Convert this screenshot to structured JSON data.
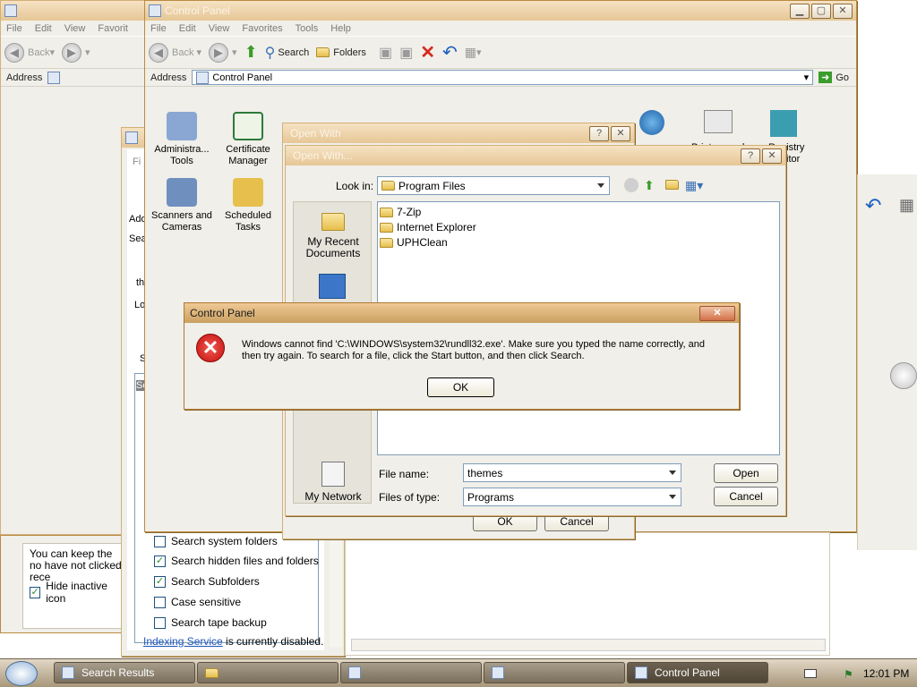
{
  "explorer_left": {
    "menu": [
      "File",
      "Edit",
      "View",
      "Favorit"
    ],
    "back_label": "Back",
    "address_label": "Address"
  },
  "control_panel": {
    "title": "Control Panel",
    "menu": [
      "File",
      "Edit",
      "View",
      "Favorites",
      "Tools",
      "Help"
    ],
    "toolbar": {
      "back": "Back",
      "search": "Search",
      "folders": "Folders"
    },
    "address_label": "Address",
    "address_value": "Control Panel",
    "go_label": "Go",
    "items": [
      {
        "label": "Administra... Tools",
        "icon": "admin-tools-icon",
        "color": "#8aa6d2"
      },
      {
        "label": "Certificate Manager",
        "icon": "certificate-icon",
        "color": "#2d7a3b"
      },
      {
        "label": "Scanners and Cameras",
        "icon": "scanner-icon",
        "color": "#6f8fbf"
      },
      {
        "label": "Scheduled Tasks",
        "icon": "scheduled-folder-icon",
        "color": "#e6bf4d"
      }
    ],
    "partial_labels": [
      "Printers and",
      "Registry",
      "itor"
    ]
  },
  "search_window": {
    "options": [
      {
        "label": "Search system folders",
        "checked": false
      },
      {
        "label": "Search hidden files and folders",
        "checked": true
      },
      {
        "label": "Search Subfolders",
        "checked": true
      },
      {
        "label": "Case sensitive",
        "checked": false
      },
      {
        "label": "Search tape backup",
        "checked": false
      }
    ],
    "indexing_link": "Indexing Service",
    "indexing_rest": " is currently disabled.",
    "side_letters": [
      "Fi",
      "Add",
      "Sea",
      "th",
      "Lo",
      "S",
      "Se"
    ]
  },
  "taskbar_props": {
    "hint_text": "You can keep the no have not clicked rece",
    "hide_inactive": "Hide inactive icon",
    "hide_inactive_checked": true
  },
  "open_with": {
    "title": "Open With",
    "ok": "OK",
    "cancel": "Cancel"
  },
  "open_with_browse": {
    "title": "Open With...",
    "look_in_label": "Look in:",
    "look_in_value": "Program Files",
    "places": [
      "My Recent Documents",
      "My Network"
    ],
    "files": [
      "7-Zip",
      "Internet Explorer",
      "UPHClean"
    ],
    "file_name_label": "File name:",
    "file_name_value": "themes",
    "file_type_label": "Files of type:",
    "file_type_value": "Programs",
    "open_button": "Open",
    "cancel_button": "Cancel"
  },
  "error_dialog": {
    "title": "Control Panel",
    "message_line1": "Windows cannot find 'C:\\WINDOWS\\system32\\rundll32.exe'. Make sure you typed the name correctly, and",
    "message_line2": "then try again. To search for a file, click the Start button, and then click Search.",
    "ok_button": "OK"
  },
  "taskbar": {
    "tasks": [
      "Search Results",
      "",
      "",
      "",
      "Control Panel"
    ],
    "clock": "12:01 PM"
  }
}
